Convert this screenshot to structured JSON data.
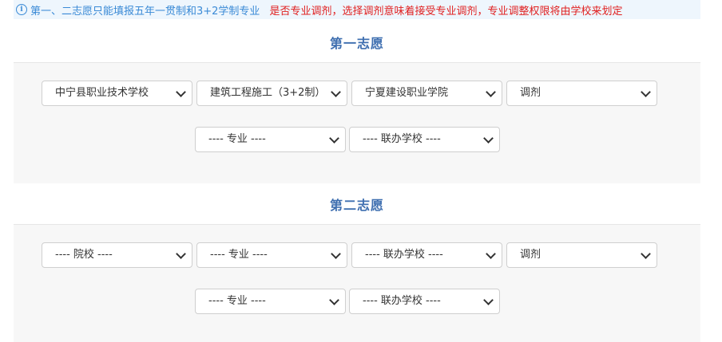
{
  "notice": {
    "icon": "info-icon",
    "main_text": "第一、二志愿只能填报五年一贯制和3+2学制专业",
    "warning_text": "是否专业调剂，选择调剂意味着接受专业调剂，专业调整权限将由学校来划定",
    "colors": {
      "main": "#3a8ad6",
      "warning": "#e02020",
      "background": "#eef6fd"
    }
  },
  "choice1": {
    "title": "第一志愿",
    "row1": {
      "school": "中宁县职业技术学校",
      "major": "建筑工程施工（3+2制）",
      "partner_school": "宁夏建设职业学院",
      "adjust": "调剂"
    },
    "row2": {
      "major": "---- 专业 ----",
      "partner_school": "---- 联办学校 ----"
    }
  },
  "choice2": {
    "title": "第二志愿",
    "row1": {
      "school": "---- 院校 ----",
      "major": "---- 专业 ----",
      "partner_school": "---- 联办学校 ----",
      "adjust": "调剂"
    },
    "row2": {
      "major": "---- 专业 ----",
      "partner_school": "---- 联办学校 ----"
    }
  },
  "colors": {
    "title": "#3f6fb0",
    "panel": "#f7f7f7"
  }
}
